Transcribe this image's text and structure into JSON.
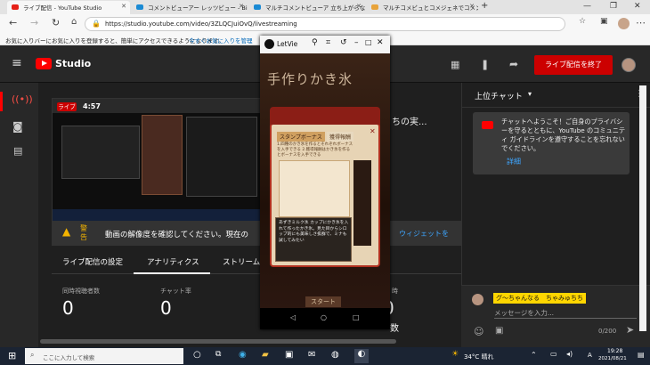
{
  "browser": {
    "tabs": [
      {
        "label": "ライブ配信 - YouTube Studio",
        "color": "#e62117"
      },
      {
        "label": "コメントビューアー レッツビュー - Bing",
        "color": "#1a8ad4"
      },
      {
        "label": "マルチコメントビューア 立ち上がらない",
        "color": "#1a8ad4"
      },
      {
        "label": "マルチコメビュとコメジェネでコメント表",
        "color": "#e8a33a"
      }
    ],
    "new_tab": "+",
    "url": "https://studio.youtube.com/video/3ZLQCJuiOvQ/livestreaming",
    "bookmark_bar_text": "お気に入りバーにお気に入りを登録すると、簡単にアクセスできるようになります。",
    "bookmark_bar_link": "今すぐお気に入りを管理"
  },
  "studio": {
    "logo_text": "Studio",
    "end_stream_button": "ライブ配信を終了",
    "live_badge": "ライブ",
    "elapsed": "4:57",
    "stream_title_fragment": "ちの実...",
    "warning_label": "警告",
    "warning_text": "動画の解像度を確認してください。現在の",
    "widget_link": "ウィジェットを",
    "tabs": [
      "ライブ配信の設定",
      "アナリティクス",
      "ストリームの"
    ],
    "stats": [
      {
        "label": "同時視聴者数",
        "value": "0"
      },
      {
        "label": "チャット率",
        "value": "0"
      }
    ],
    "stat_fragment_right": "時",
    "stat_fragment_right_value": "0",
    "count_fragment": "数"
  },
  "chat": {
    "header": "上位チャット",
    "welcome": "チャットへようこそ！ご自身のプライバシーを守るとともに、YouTube のコミュニティ ガイドラインを遵守することを忘れないでください。",
    "details_link": "詳細",
    "username": "グ〜ちゃんなる　ちゃみゅちち",
    "placeholder": "メッセージを入力...",
    "counter": "0/200"
  },
  "phone": {
    "app_title": "LetVie",
    "game_title": "手作りかき氷",
    "tab_stamp": "スタンプボーナス",
    "tab_gain": "獲得報酬",
    "desc": "1.四種のかき氷を作るとそれぞれボーナスを入手できる 2.獲得報酬はかき氷を作るとボーナスを入手できる",
    "tip": "あずきミルク氷 カップにかき氷を入れて作ったかき氷。見た目からシロップ的にも美味しさ抜群で、ミナも試してみたい",
    "start_button": "スタート"
  },
  "taskbar": {
    "search_placeholder": "ここに入力して検索",
    "weather": "34°C 晴れ",
    "ime": "A",
    "time": "19:28",
    "date": "2021/08/21"
  },
  "colors": {
    "accent_red": "#cc0000",
    "youtube_red": "#ff0000",
    "link_blue": "#3ea6ff"
  }
}
